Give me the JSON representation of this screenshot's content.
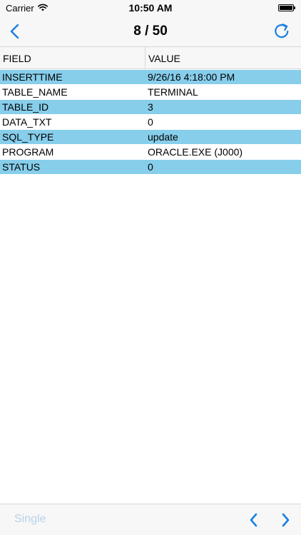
{
  "status_bar": {
    "carrier": "Carrier",
    "time": "10:50 AM",
    "icons": [
      "wifi-icon",
      "battery-icon"
    ]
  },
  "nav": {
    "title": "8 / 50",
    "icons": [
      "chevron-left-icon",
      "refresh-icon"
    ]
  },
  "table": {
    "headers": {
      "field": "FIELD",
      "value": "VALUE"
    },
    "rows": [
      {
        "field": "INSERTTIME",
        "value": "9/26/16 4:18:00 PM"
      },
      {
        "field": "TABLE_NAME",
        "value": "TERMINAL"
      },
      {
        "field": "TABLE_ID",
        "value": "3"
      },
      {
        "field": "DATA_TXT",
        "value": "0"
      },
      {
        "field": "SQL_TYPE",
        "value": "update"
      },
      {
        "field": "PROGRAM",
        "value": "ORACLE.EXE (J000)"
      },
      {
        "field": "STATUS",
        "value": "0"
      }
    ]
  },
  "toolbar": {
    "single_label": "Single",
    "icons": [
      "chevron-left-icon",
      "chevron-right-icon"
    ]
  },
  "colors": {
    "accent": "#1a7fe0",
    "row_highlight": "#87ceeb",
    "disabled": "#b9d2ea"
  }
}
